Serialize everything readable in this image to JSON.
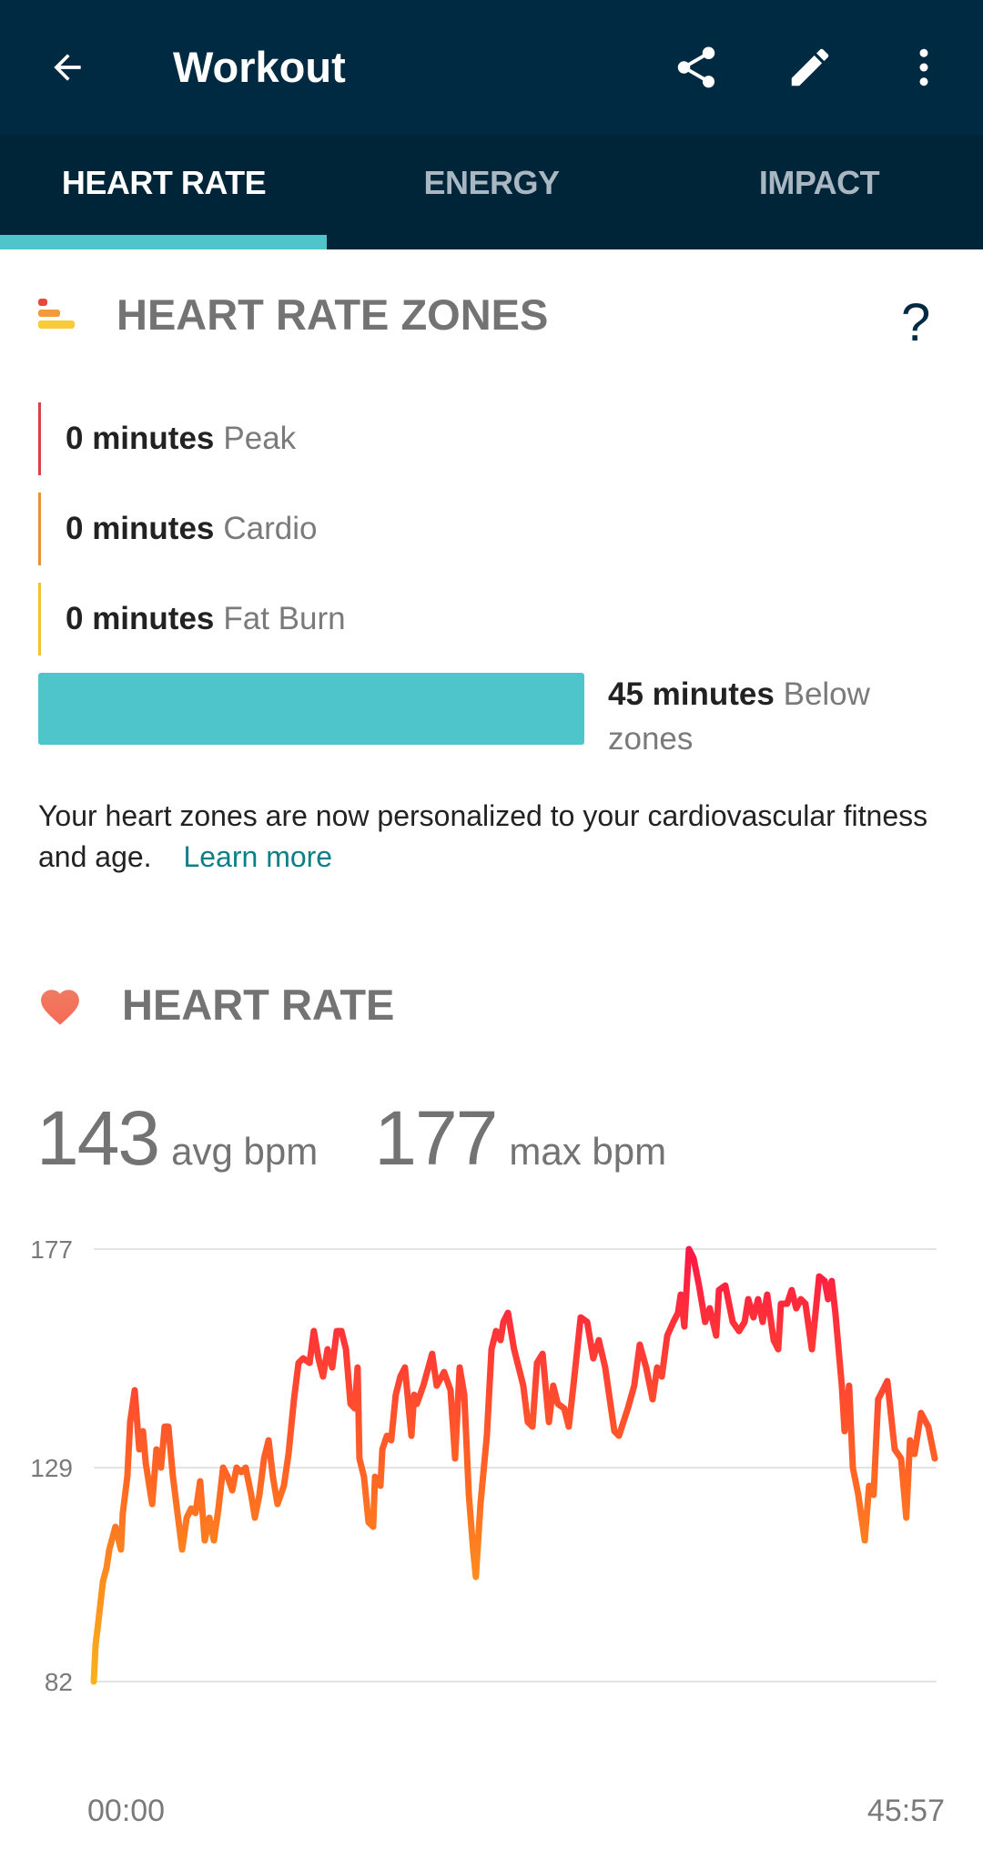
{
  "appbar": {
    "title": "Workout",
    "icons": [
      "back-arrow-icon",
      "share-icon",
      "edit-pencil-icon",
      "more-vert-icon"
    ],
    "colors": {
      "background": "#002a42",
      "tab_background": "#002538",
      "accent": "#4ec5cb"
    }
  },
  "tabs": [
    {
      "label": "HEART RATE",
      "active": true
    },
    {
      "label": "ENERGY",
      "active": false
    },
    {
      "label": "IMPACT",
      "active": false
    }
  ],
  "zones": {
    "title": "HEART RATE ZONES",
    "help_label": "?",
    "rows": [
      {
        "minutes": "0 minutes",
        "label": "Peak",
        "color": "#d9414e"
      },
      {
        "minutes": "0 minutes",
        "label": "Cardio",
        "color": "#e89136"
      },
      {
        "minutes": "0 minutes",
        "label": "Fat Burn",
        "color": "#f2c030"
      }
    ],
    "below": {
      "minutes": "45 minutes",
      "label": "Below zones",
      "color": "#4ec5cb"
    },
    "note": "Your heart zones are now personalized to your cardiovascular fitness and age.",
    "learn_more": "Learn more"
  },
  "heart_rate": {
    "title": "HEART RATE",
    "avg_value": "143",
    "avg_label": "avg bpm",
    "max_value": "177",
    "max_label": "max bpm"
  },
  "chart_data": {
    "type": "line",
    "title": "",
    "xlabel": "",
    "ylabel": "bpm",
    "ylim": [
      82,
      177
    ],
    "yticks": [
      177,
      129,
      82
    ],
    "ytick_labels": [
      "177",
      "129",
      "82"
    ],
    "xlim_seconds": [
      0,
      2757
    ],
    "xtick_labels": [
      "00:00",
      "45:57"
    ],
    "grid": true,
    "gradient_colors": {
      "low": "#f7b21c",
      "mid": "#ff6a22",
      "high": "#ff1744"
    },
    "series": [
      {
        "name": "heart rate",
        "x_seconds": [
          0,
          6,
          15,
          30,
          42,
          51,
          71,
          89,
          95,
          110,
          119,
          134,
          149,
          161,
          170,
          191,
          205,
          220,
          232,
          244,
          259,
          274,
          289,
          304,
          319,
          333,
          348,
          363,
          378,
          393,
          408,
          423,
          438,
          453,
          467,
          482,
          497,
          515,
          527,
          542,
          557,
          572,
          586,
          601,
          622,
          637,
          655,
          670,
          685,
          706,
          720,
          735,
          750,
          765,
          780,
          795,
          810,
          825,
          840,
          854,
          863,
          869,
          884,
          899,
          914,
          920,
          938,
          944,
          959,
          973,
          988,
          1003,
          1018,
          1039,
          1048,
          1057,
          1078,
          1107,
          1122,
          1146,
          1167,
          1182,
          1197,
          1212,
          1227,
          1241,
          1250,
          1265,
          1286,
          1301,
          1316,
          1331,
          1340,
          1355,
          1375,
          1390,
          1405,
          1420,
          1435,
          1450,
          1468,
          1489,
          1503,
          1518,
          1539,
          1554,
          1569,
          1593,
          1614,
          1634,
          1652,
          1673,
          1703,
          1718,
          1747,
          1768,
          1786,
          1807,
          1828,
          1843,
          1858,
          1876,
          1896,
          1911,
          1920,
          1932,
          1947,
          1962,
          1980,
          2000,
          2015,
          2036,
          2045,
          2066,
          2090,
          2111,
          2129,
          2141,
          2158,
          2173,
          2188,
          2203,
          2224,
          2239,
          2248,
          2268,
          2283,
          2298,
          2313,
          2328,
          2349,
          2361,
          2373,
          2391,
          2402,
          2414,
          2426,
          2447,
          2456,
          2471,
          2483,
          2501,
          2522,
          2536,
          2551,
          2566,
          2581,
          2596,
          2620,
          2641,
          2658,
          2670,
          2685,
          2706,
          2730,
          2751
        ],
        "bpm": [
          82,
          90,
          95,
          104,
          107,
          111,
          116,
          111,
          119,
          127,
          139,
          146,
          133,
          137,
          130,
          121,
          133,
          129,
          138,
          138,
          127,
          119,
          111,
          118,
          120,
          119,
          126,
          113,
          118,
          113,
          120,
          129,
          127,
          124,
          129,
          128,
          129,
          123,
          118,
          123,
          131,
          135,
          127,
          121,
          125,
          132,
          144,
          152,
          153,
          152,
          159,
          153,
          149,
          155,
          151,
          159,
          159,
          155,
          143,
          142,
          151,
          131,
          127,
          117,
          116,
          127,
          125,
          133,
          136,
          135,
          145,
          149,
          151,
          136,
          145,
          143,
          147,
          154,
          147,
          150,
          146,
          131,
          151,
          145,
          123,
          111,
          105,
          121,
          136,
          155,
          159,
          157,
          161,
          163,
          155,
          151,
          147,
          139,
          138,
          152,
          154,
          139,
          147,
          143,
          142,
          138,
          147,
          162,
          161,
          153,
          157,
          151,
          137,
          136,
          142,
          147,
          156,
          151,
          144,
          151,
          149,
          158,
          161,
          163,
          167,
          160,
          177,
          175,
          169,
          161,
          164,
          158,
          168,
          169,
          161,
          159,
          161,
          166,
          162,
          166,
          161,
          167,
          157,
          155,
          165,
          165,
          168,
          164,
          166,
          165,
          155,
          163,
          171,
          170,
          166,
          170,
          163,
          147,
          137,
          147,
          129,
          123,
          113,
          125,
          123,
          144,
          146,
          148,
          133,
          131,
          118,
          135,
          132,
          141,
          138,
          131
        ]
      }
    ]
  }
}
